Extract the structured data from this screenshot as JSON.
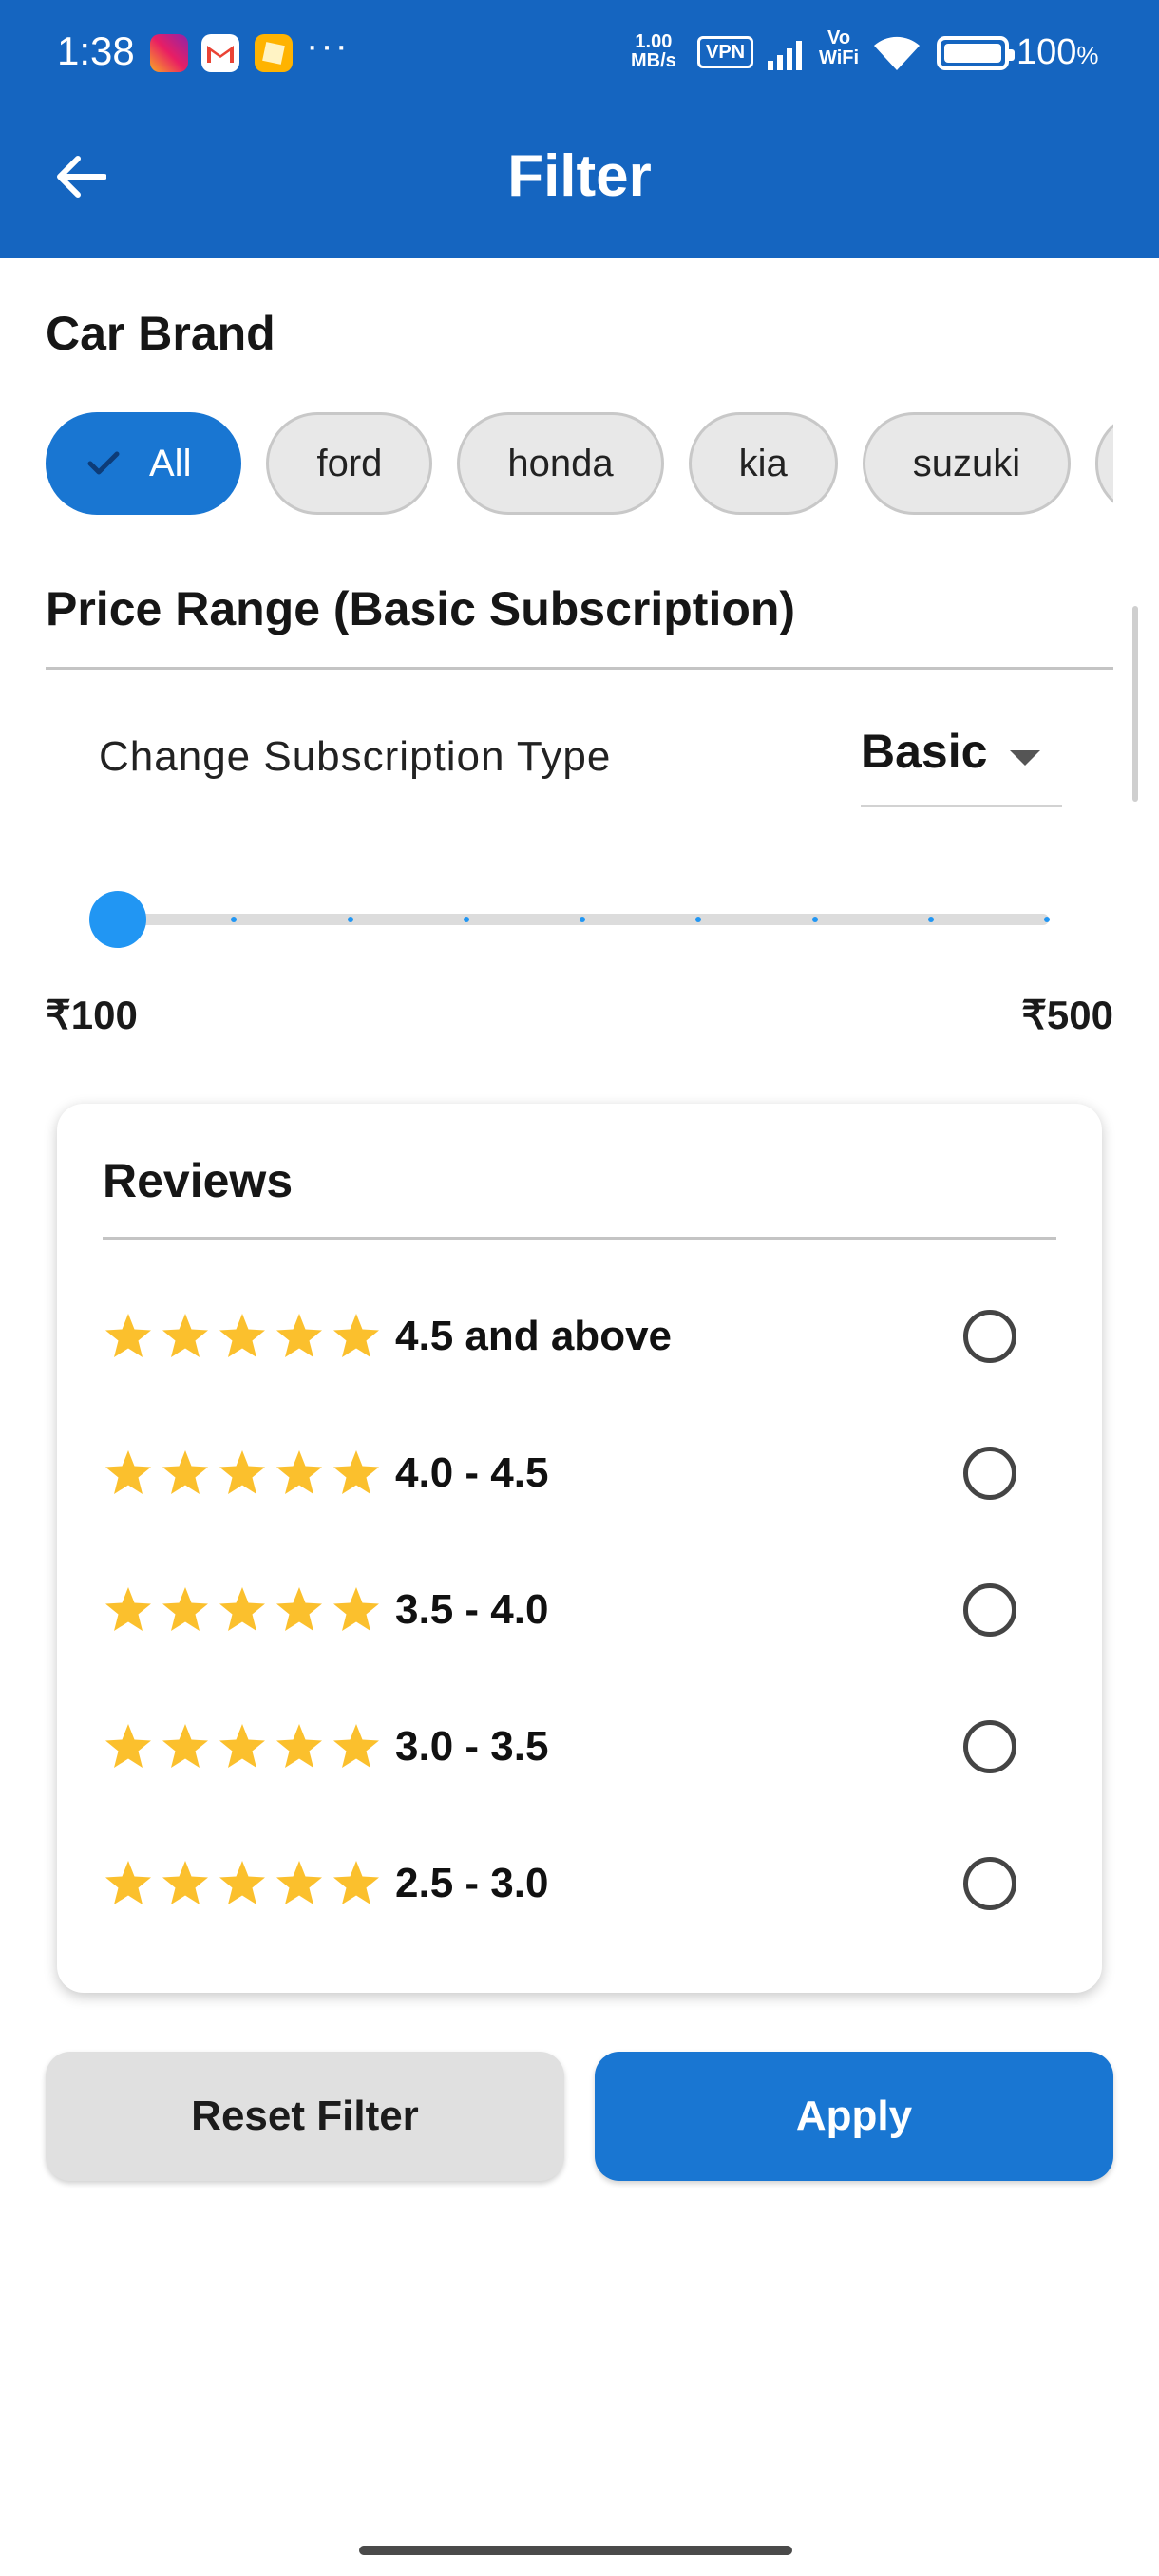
{
  "status_bar": {
    "time": "1:38",
    "net_speed_value": "1.00",
    "net_speed_unit": "MB/s",
    "vpn": "VPN",
    "vowifi_top": "Vo",
    "vowifi_bottom": "WiFi",
    "battery": "100",
    "battery_unit": "%",
    "overflow": "···",
    "notification_icons": [
      "instagram-icon",
      "gmail-icon",
      "notes-icon"
    ]
  },
  "header": {
    "title": "Filter",
    "back_icon": "arrow-left-icon",
    "color": "#1565c0"
  },
  "car_brand": {
    "title": "Car Brand",
    "chips": [
      {
        "label": "All",
        "selected": true
      },
      {
        "label": "ford",
        "selected": false
      },
      {
        "label": "honda",
        "selected": false
      },
      {
        "label": "kia",
        "selected": false
      },
      {
        "label": "suzuki",
        "selected": false
      },
      {
        "label": "",
        "selected": false
      }
    ],
    "accent": "#1976d2"
  },
  "price_range": {
    "title": "Price Range (Basic Subscription)",
    "subscription_label": "Change Subscription Type",
    "subscription_value": "Basic",
    "min_label": "₹100",
    "max_label": "₹500",
    "slider_value_fraction": 0,
    "slider_ticks": 9
  },
  "reviews": {
    "title": "Reviews",
    "star_color": "#fbc02d",
    "options": [
      {
        "label": "4.5 and above",
        "stars": 5,
        "selected": false
      },
      {
        "label": "4.0 - 4.5",
        "stars": 5,
        "selected": false
      },
      {
        "label": "3.5 - 4.0",
        "stars": 5,
        "selected": false
      },
      {
        "label": "3.0 - 3.5",
        "stars": 5,
        "selected": false
      },
      {
        "label": "2.5 - 3.0",
        "stars": 5,
        "selected": false
      }
    ]
  },
  "actions": {
    "reset_label": "Reset Filter",
    "apply_label": "Apply"
  }
}
